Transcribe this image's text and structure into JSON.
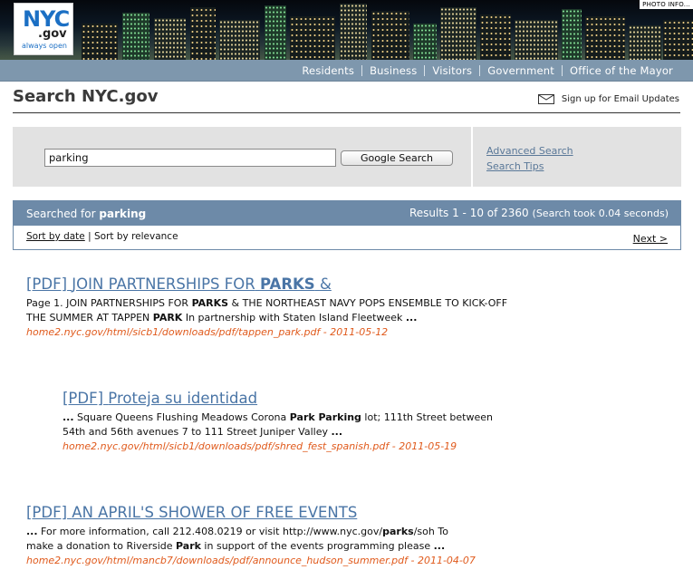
{
  "banner": {
    "logo": {
      "line1": "NYC",
      "line2": ".gov",
      "line3": "always open"
    },
    "photo_info": "PHOTO INFO..."
  },
  "nav": {
    "items": [
      "Residents",
      "Business",
      "Visitors",
      "Government",
      "Office of the Mayor"
    ]
  },
  "header": {
    "title": "Search NYC.gov",
    "email_updates": "Sign up for Email Updates"
  },
  "search": {
    "query": "parking",
    "button_label": "Google Search",
    "advanced_link": "Advanced Search",
    "tips_link": "Search Tips"
  },
  "results_bar": {
    "searched_prefix": "Searched for",
    "searched_term": "parking",
    "results_range": "Results 1 - 10 of 2360",
    "took": "(Search took 0.04 seconds)"
  },
  "sort": {
    "by_date": "Sort by date",
    "separator": "|",
    "by_relevance": "Sort by relevance",
    "next": "Next >"
  },
  "results": [
    {
      "tag": "[PDF]",
      "title_plain": "JOIN PARTNERSHIPS FOR",
      "title_bold": "PARKS",
      "title_tail": "&",
      "snippet_lines": [
        [
          "Page 1. JOIN PARTNERSHIPS FOR ",
          "PARKS",
          " & THE NORTHEAST NAVY POPS ENSEMBLE TO KICK-OFF"
        ],
        [
          "THE SUMMER AT TAPPEN ",
          "PARK",
          " In partnership with Staten Island Fleetweek ",
          "..."
        ]
      ],
      "url": "home2.nyc.gov/html/sicb1/downloads/pdf/tappen_park.pdf - 2011-05-12"
    },
    {
      "tag": "[PDF]",
      "title_plain": "Proteja su identidad",
      "snippet_lines": [
        [
          "...",
          " Square Queens Flushing Meadows Corona ",
          "Park Parking",
          " lot; 111th Street between"
        ],
        [
          "54th and 56th avenues 7 to 111 Street Juniper Valley ",
          "..."
        ]
      ],
      "url": "home2.nyc.gov/html/sicb1/downloads/pdf/shred_fest_spanish.pdf - 2011-05-19"
    },
    {
      "tag": "[PDF]",
      "title_plain": "AN APRIL'S SHOWER OF FREE EVENTS",
      "snippet_lines": [
        [
          "...",
          " For more information, call 212.408.0219 or visit http://www.nyc.gov/",
          "parks",
          "/soh To"
        ],
        [
          "make a donation to Riverside ",
          "Park",
          " in support of the events programming please ",
          "..."
        ]
      ],
      "url": "home2.nyc.gov/html/mancb7/downloads/pdf/announce_hudson_summer.pdf - 2011-04-07"
    }
  ],
  "colors": {
    "nav_bg": "#7e97ad",
    "results_bar_bg": "#6d8aa8",
    "link_blue": "#4a75a6",
    "url_orange": "#e05a1c",
    "panel_gray": "#e2e2e2"
  }
}
